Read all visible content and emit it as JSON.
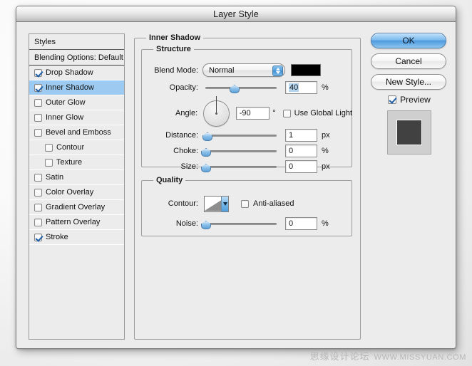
{
  "window": {
    "title": "Layer Style"
  },
  "styles_panel": {
    "header": "Styles",
    "blending_options": "Blending Options: Default",
    "items": [
      {
        "label": "Drop Shadow",
        "checked": true,
        "selected": false,
        "indent": false
      },
      {
        "label": "Inner Shadow",
        "checked": true,
        "selected": true,
        "indent": false
      },
      {
        "label": "Outer Glow",
        "checked": false,
        "selected": false,
        "indent": false
      },
      {
        "label": "Inner Glow",
        "checked": false,
        "selected": false,
        "indent": false
      },
      {
        "label": "Bevel and Emboss",
        "checked": false,
        "selected": false,
        "indent": false
      },
      {
        "label": "Contour",
        "checked": false,
        "selected": false,
        "indent": true
      },
      {
        "label": "Texture",
        "checked": false,
        "selected": false,
        "indent": true
      },
      {
        "label": "Satin",
        "checked": false,
        "selected": false,
        "indent": false
      },
      {
        "label": "Color Overlay",
        "checked": false,
        "selected": false,
        "indent": false
      },
      {
        "label": "Gradient Overlay",
        "checked": false,
        "selected": false,
        "indent": false
      },
      {
        "label": "Pattern Overlay",
        "checked": false,
        "selected": false,
        "indent": false
      },
      {
        "label": "Stroke",
        "checked": true,
        "selected": false,
        "indent": false
      }
    ]
  },
  "effect_panel": {
    "title": "Inner Shadow",
    "structure": {
      "title": "Structure",
      "blend_mode": {
        "label": "Blend Mode:",
        "value": "Normal",
        "stepper_icon": "updown-stepper-icon",
        "color": "#000000"
      },
      "opacity": {
        "label": "Opacity:",
        "value": "40",
        "unit": "%",
        "percent": 40,
        "selected": true
      },
      "angle": {
        "label": "Angle:",
        "value": "-90",
        "unit": "°",
        "degrees": -90,
        "dial_icon": "angle-dial-icon"
      },
      "use_global_light": {
        "label": "Use Global Light",
        "checked": false
      },
      "distance": {
        "label": "Distance:",
        "value": "1",
        "unit": "px",
        "percent": 2
      },
      "choke": {
        "label": "Choke:",
        "value": "0",
        "unit": "%",
        "percent": 0
      },
      "size": {
        "label": "Size:",
        "value": "0",
        "unit": "px",
        "percent": 0
      }
    },
    "quality": {
      "title": "Quality",
      "contour": {
        "label": "Contour:",
        "thumb_icon": "contour-curve-icon",
        "arrow_icon": "chevron-down-icon"
      },
      "anti_aliased": {
        "label": "Anti-aliased",
        "checked": false
      },
      "noise": {
        "label": "Noise:",
        "value": "0",
        "unit": "%",
        "percent": 0
      }
    }
  },
  "buttons": {
    "ok": "OK",
    "cancel": "Cancel",
    "new_style": "New Style...",
    "preview": {
      "label": "Preview",
      "checked": true
    }
  },
  "preview_swatch": {
    "background": "#cfcfcf",
    "fill": "#414141"
  },
  "watermark": {
    "chinese": "思缘设计论坛",
    "url": "WWW.MISSYUAN.COM"
  },
  "colors": {
    "accent": "#4f9ddc",
    "selection": "#9ccaf0",
    "window_bg": "#ececec",
    "text": "#111111"
  }
}
